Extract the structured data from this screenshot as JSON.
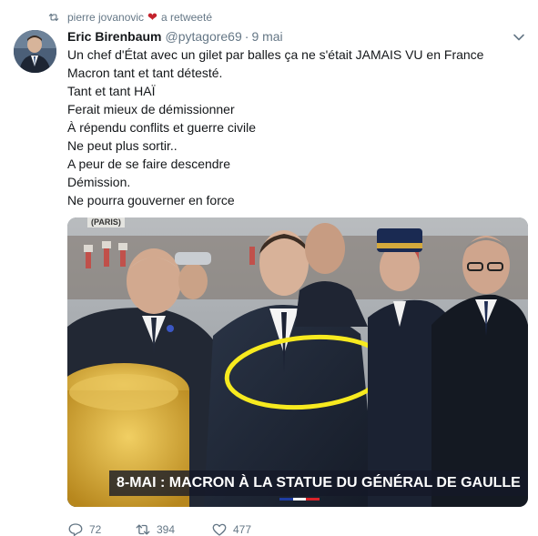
{
  "retweet_bar": {
    "retweeter": "pierre jovanovic",
    "suffix": "a retweeté"
  },
  "tweet": {
    "author_name": "Eric Birenbaum",
    "handle": "@pytagore69",
    "separator": "·",
    "time": "9 mai",
    "lines": [
      "Un chef d'État avec un gilet par balles ça ne s'était JAMAIS VU en France",
      "Macron tant et tant détesté.",
      "Tant et tant HAÏ",
      "Ferait mieux de démissionner",
      "À répendu conflits et guerre civile",
      "Ne peut plus sortir..",
      "A peur de se faire descendre",
      "Démission.",
      "Ne pourra gouverner en force"
    ]
  },
  "media": {
    "top_banner": "(PARIS)",
    "caption": "8-MAI : MACRON À LA STATUE DU GÉNÉRAL DE GAULLE",
    "highlight_color": "#f7ea1f"
  },
  "actions": {
    "replies": "72",
    "retweets": "394",
    "likes": "477"
  },
  "icons": {
    "retweet": "retweet-icon",
    "heart": "heart-icon",
    "reply": "reply-icon",
    "like": "like-icon",
    "chevron": "chevron-down-icon"
  },
  "colors": {
    "muted": "#657786",
    "heart": "#c4232d",
    "text": "#14171a"
  }
}
